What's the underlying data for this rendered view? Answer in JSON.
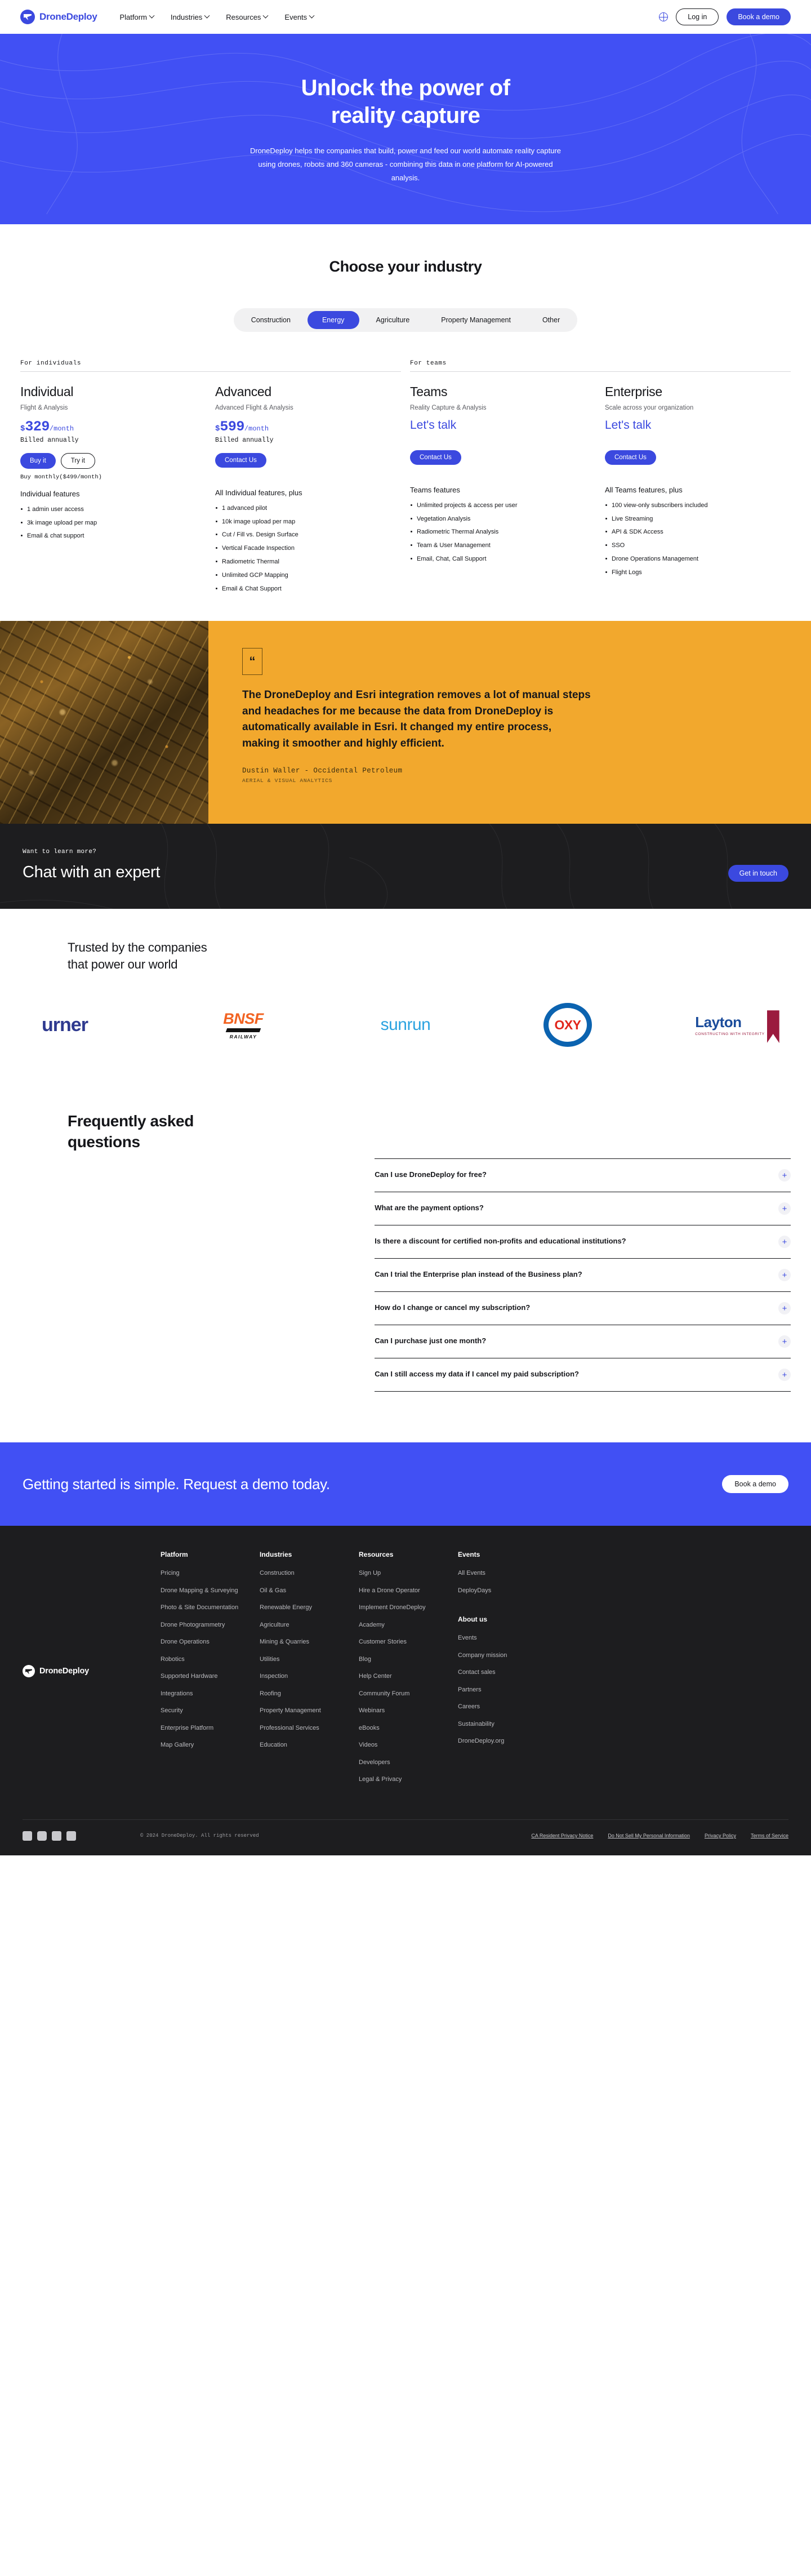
{
  "header": {
    "brand": "DroneDeploy",
    "nav": [
      "Platform",
      "Industries",
      "Resources",
      "Events"
    ],
    "login": "Log in",
    "demo": "Book a demo"
  },
  "hero": {
    "title_line1": "Unlock the power of",
    "title_line2": "reality capture",
    "body": "DroneDeploy helps the companies that build, power and feed our world automate reality capture using drones, robots and 360 cameras - combining this data in one platform for AI-powered analysis."
  },
  "industry": {
    "heading": "Choose your industry",
    "tabs": [
      "Construction",
      "Energy",
      "Agriculture",
      "Property Management",
      "Other"
    ],
    "active_tab": "Energy"
  },
  "pricing": {
    "groups": [
      {
        "label": "For individuals",
        "cards": [
          {
            "name": "Individual",
            "sub": "Flight & Analysis",
            "currency": "$",
            "amount": "329",
            "per": "/month",
            "billed": "Billed annually",
            "buttons": [
              "Buy it",
              "Try it"
            ],
            "buy_monthly": "Buy monthly($499/month)",
            "features_title": "Individual features",
            "features": [
              "1 admin user access",
              "3k image upload per map",
              "Email & chat support"
            ]
          },
          {
            "name": "Advanced",
            "sub": "Advanced Flight & Analysis",
            "currency": "$",
            "amount": "599",
            "per": "/month",
            "billed": "Billed annually",
            "buttons": [
              "Contact Us"
            ],
            "features_title": "All Individual features, plus",
            "features": [
              "1 advanced pilot",
              "10k image upload per map",
              "Cut / Fill vs. Design Surface",
              "Vertical Facade Inspection",
              "Radiometric Thermal",
              "Unlimited GCP Mapping",
              "Email & Chat Support"
            ]
          }
        ]
      },
      {
        "label": "For teams",
        "cards": [
          {
            "name": "Teams",
            "sub": "Reality Capture & Analysis",
            "price_text": "Let's talk",
            "buttons": [
              "Contact Us"
            ],
            "features_title": "Teams features",
            "features": [
              "Unlimited projects & access per user",
              "Vegetation Analysis",
              "Radiometric Thermal Analysis",
              "Team & User Management",
              "Email, Chat, Call Support"
            ]
          },
          {
            "name": "Enterprise",
            "sub": "Scale across your organization",
            "price_text": "Let's talk",
            "buttons": [
              "Contact Us"
            ],
            "features_title": "All Teams features, plus",
            "features": [
              "100 view-only subscribers included",
              "Live Streaming",
              "API & SDK Access",
              "SSO",
              "Drone Operations Management",
              "Flight Logs"
            ]
          }
        ]
      }
    ]
  },
  "testimonial": {
    "quote_mark": "“",
    "quote": "The DroneDeploy and Esri integration removes a lot of manual steps and headaches for me because the data from DroneDeploy is automatically available in Esri. It changed my entire process, making it smoother and highly efficient.",
    "name": "Dustin Waller - Occidental Petroleum",
    "role": "AERIAL & VISUAL ANALYTICS"
  },
  "expert": {
    "eyebrow": "Want to learn more?",
    "heading": "Chat with an expert",
    "button": "Get in touch"
  },
  "trusted": {
    "heading_line1": "Trusted by the companies",
    "heading_line2": "that power our world",
    "logos": [
      "Turner",
      "BNSF RAILWAY",
      "sunrun",
      "OXY",
      "Layton"
    ],
    "bnsf_main": "BNSF",
    "bnsf_sub": "RAILWAY",
    "turner": "urner",
    "sunrun": "sunrun",
    "oxy": "OXY",
    "layton_main": "Layton",
    "layton_sub": "CONSTRUCTING WITH INTEGRITY"
  },
  "faq": {
    "heading_line1": "Frequently asked",
    "heading_line2": "questions",
    "items": [
      "Can I use DroneDeploy for free?",
      "What are the payment options?",
      "Is there a discount for certified non-profits and educational institutions?",
      "Can I trial the Enterprise plan instead of the Business plan?",
      "How do I change or cancel my subscription?",
      "Can I purchase just one month?",
      "Can I still access my data if I cancel my paid subscription?"
    ],
    "expand_icon": "+"
  },
  "cta": {
    "heading": "Getting started is simple. Request a demo today.",
    "button": "Book a demo"
  },
  "footer": {
    "brand": "DroneDeploy",
    "columns": [
      {
        "title": "Platform",
        "links": [
          "Pricing",
          "Drone Mapping & Surveying",
          "Photo & Site Documentation",
          "Drone Photogrammetry",
          "Drone Operations",
          "Robotics",
          "Supported Hardware",
          "Integrations",
          "Security",
          "Enterprise Platform",
          "Map Gallery"
        ]
      },
      {
        "title": "Industries",
        "links": [
          "Construction",
          "Oil & Gas",
          "Renewable Energy",
          "Agriculture",
          "Mining & Quarries",
          "Utilities",
          "Inspection",
          "Roofing",
          "Property Management",
          "Professional Services",
          "Education"
        ]
      },
      {
        "title": "Resources",
        "links": [
          "Sign Up",
          "Hire a Drone Operator",
          "Implement DroneDeploy",
          "Academy",
          "Customer Stories",
          "Blog",
          "Help Center",
          "Community Forum",
          "Webinars",
          "eBooks",
          "Videos",
          "Developers",
          "Legal & Privacy"
        ]
      },
      {
        "title": "Events",
        "links": [
          "All Events",
          "DeployDays"
        ],
        "title2": "About us",
        "links2": [
          "Events",
          "Company mission",
          "Contact sales",
          "Partners",
          "Careers",
          "Sustainability",
          "DroneDeploy.org"
        ]
      }
    ],
    "copyright": "© 2024 DroneDeploy. All rights reserved",
    "legal": [
      "CA Resident Privacy Notice",
      "Do Not Sell My Personal Information",
      "Privacy Policy",
      "Terms of Service"
    ],
    "social": [
      "linkedin-icon",
      "youtube-icon",
      "twitter-icon",
      "instagram-icon"
    ]
  },
  "colors": {
    "brand_blue": "#3B49DF",
    "hero_blue": "#4150F4",
    "accent_yellow": "#F2A82D",
    "dark": "#1d1d1f"
  }
}
